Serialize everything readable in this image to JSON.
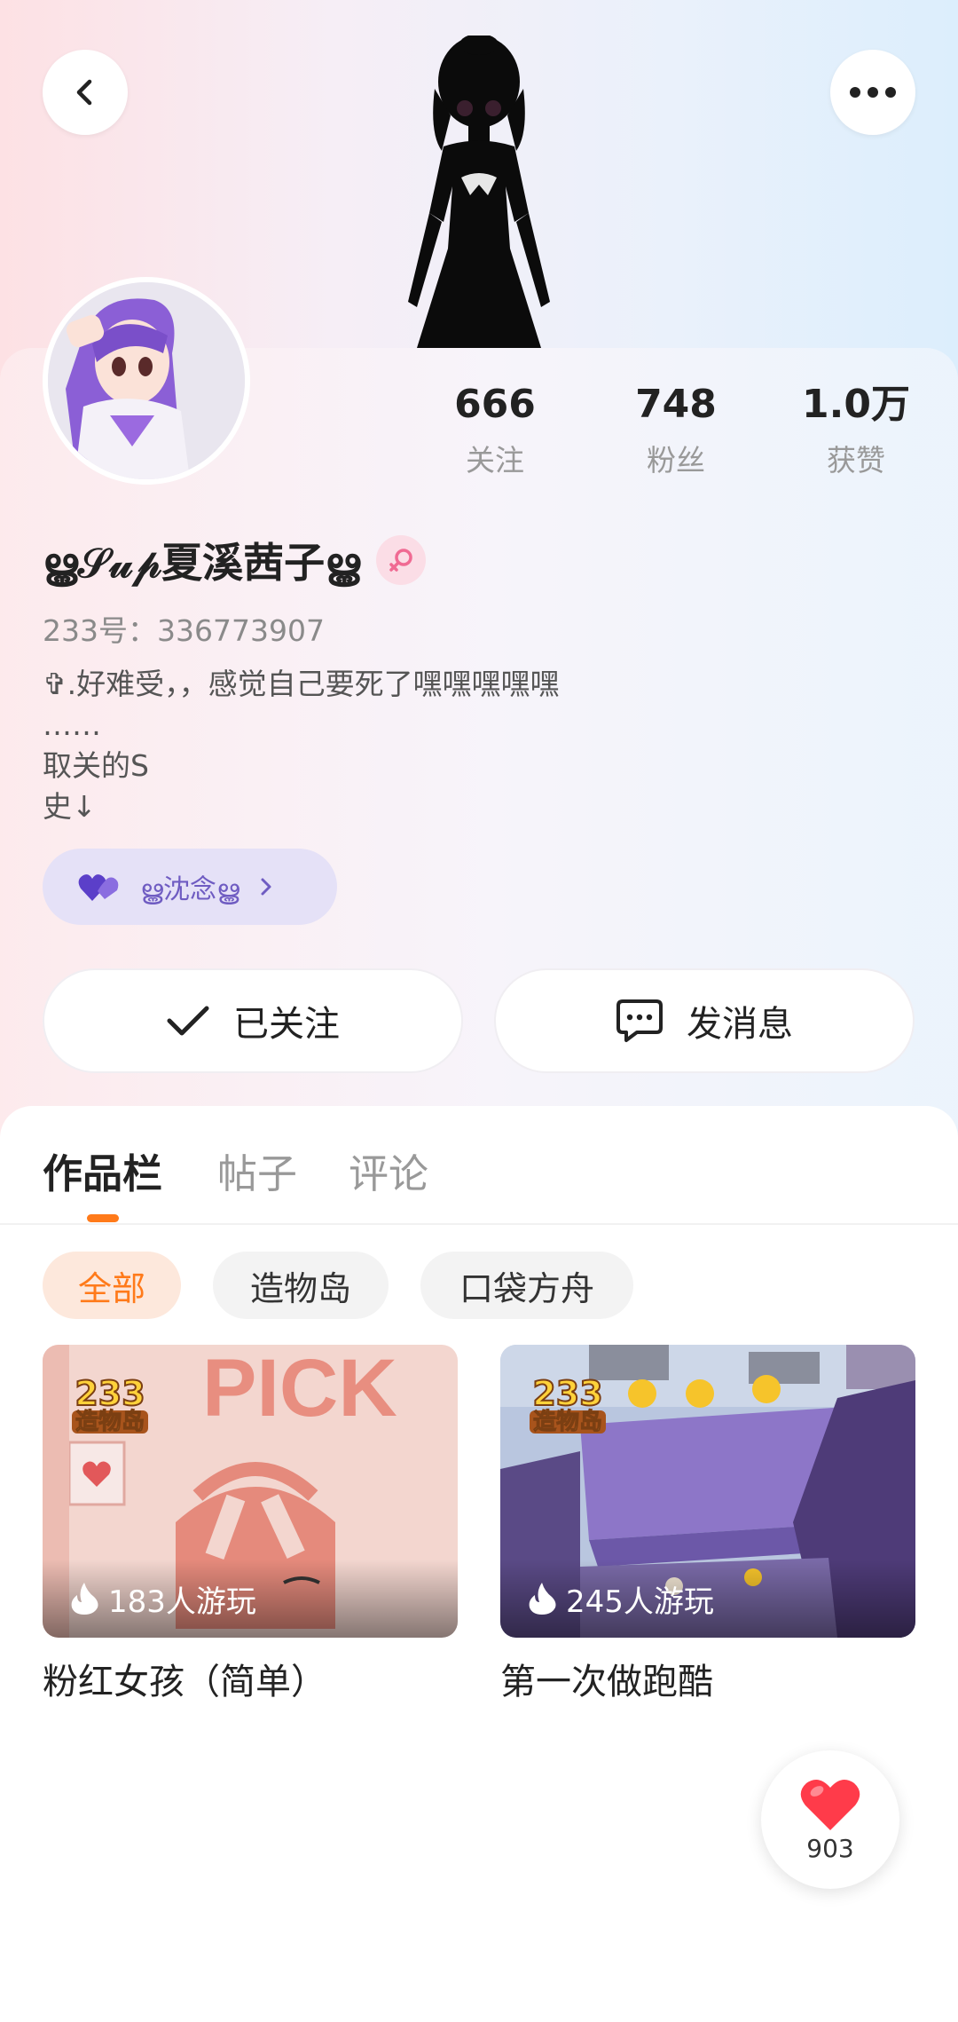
{
  "profile": {
    "name": "ൠ𝒮𝓊𝓅夏溪茜子ൠ",
    "uid": "233号：336773907",
    "bio": "✞.好难受，，感觉自己要死了嘿嘿嘿嘿嘿\n……\n取关的S\n史↓",
    "tag": "ൠ沈念ൠ",
    "gender": "female"
  },
  "stats": [
    {
      "value": "666",
      "label": "关注"
    },
    {
      "value": "748",
      "label": "粉丝"
    },
    {
      "value": "1.0万",
      "label": "获赞"
    }
  ],
  "actions": {
    "follow_label": "已关注",
    "message_label": "发消息"
  },
  "tabs": [
    "作品栏",
    "帖子",
    "评论"
  ],
  "filters": [
    "全部",
    "造物岛",
    "口袋方舟"
  ],
  "works": [
    {
      "title": "粉红女孩（简单）",
      "plays": "183人游玩",
      "badge_num": "233",
      "badge_text": "造物岛"
    },
    {
      "title": "第一次做跑酷",
      "plays": "245人游玩",
      "badge_num": "233",
      "badge_text": "造物岛"
    }
  ],
  "like_fab": {
    "count": "903"
  },
  "colors": {
    "accent": "#ff7a1a",
    "tag_bg": "#e5e1f7",
    "tag_text": "#6f5cc2",
    "like": "#ff3b4a"
  }
}
